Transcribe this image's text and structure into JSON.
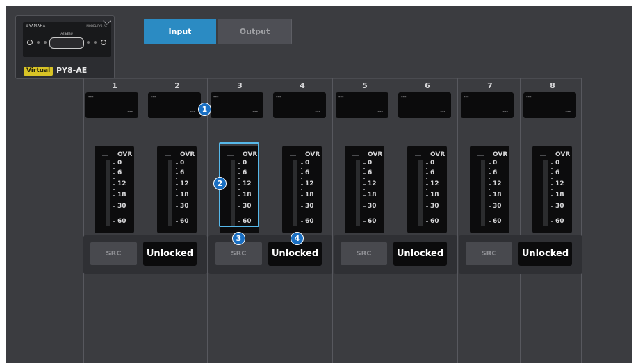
{
  "card": {
    "brand": "⊛YAMAHA",
    "model": "MODEL PY8-AE",
    "port_label": "AES/EBU",
    "virtual_badge": "Virtual",
    "name": "PY8-AE"
  },
  "tabs": [
    {
      "label": "Input",
      "active": true
    },
    {
      "label": "Output",
      "active": false
    }
  ],
  "channels": [
    {
      "number": "1",
      "line1": "---",
      "line2": "---"
    },
    {
      "number": "2",
      "line1": "---",
      "line2": "---"
    },
    {
      "number": "3",
      "line1": "---",
      "line2": "---"
    },
    {
      "number": "4",
      "line1": "---",
      "line2": "---"
    },
    {
      "number": "5",
      "line1": "---",
      "line2": "---"
    },
    {
      "number": "6",
      "line1": "---",
      "line2": "---"
    },
    {
      "number": "7",
      "line1": "---",
      "line2": "---"
    },
    {
      "number": "8",
      "line1": "---",
      "line2": "---"
    }
  ],
  "meter": {
    "peak_label": "---",
    "scale": [
      "OVR",
      "0",
      "6",
      "12",
      "18",
      "30",
      "60"
    ]
  },
  "pairs": [
    {
      "src_label": "SRC",
      "lock_label": "Unlocked"
    },
    {
      "src_label": "SRC",
      "lock_label": "Unlocked"
    },
    {
      "src_label": "SRC",
      "lock_label": "Unlocked"
    },
    {
      "src_label": "SRC",
      "lock_label": "Unlocked"
    }
  ],
  "callouts": [
    "1",
    "2",
    "3",
    "4"
  ],
  "colors": {
    "background": "#3b3c40",
    "accent": "#2b8bc3",
    "badge": "#d8c326",
    "callout": "#1a6fc2",
    "highlight": "#56b8ea"
  }
}
